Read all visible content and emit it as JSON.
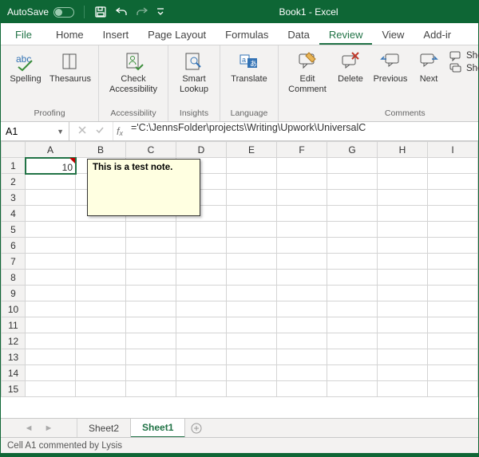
{
  "titlebar": {
    "autosave_label": "AutoSave",
    "autosave_state": "Off",
    "title": "Book1  -  Excel"
  },
  "tabs": {
    "file": "File",
    "home": "Home",
    "insert": "Insert",
    "page_layout": "Page Layout",
    "formulas": "Formulas",
    "data": "Data",
    "review": "Review",
    "view": "View",
    "addins": "Add-ir"
  },
  "ribbon": {
    "spelling": "Spelling",
    "thesaurus": "Thesaurus",
    "proofing_group": "Proofing",
    "check_accessibility": "Check Accessibility",
    "accessibility_group": "Accessibility",
    "smart_lookup": "Smart Lookup",
    "insights_group": "Insights",
    "translate": "Translate",
    "language_group": "Language",
    "edit_comment": "Edit Comment",
    "delete": "Delete",
    "previous": "Previous",
    "next": "Next",
    "comments_group": "Comments",
    "show_hide": "Show/Hide C",
    "show_all": "Show All Com"
  },
  "namebox": {
    "value": "A1"
  },
  "formula": {
    "text": "='C:\\JennsFolder\\projects\\Writing\\Upwork\\UniversalC"
  },
  "columns": [
    "A",
    "B",
    "C",
    "D",
    "E",
    "F",
    "G",
    "H",
    "I"
  ],
  "rows": [
    "1",
    "2",
    "3",
    "4",
    "5",
    "6",
    "7",
    "8",
    "9",
    "10",
    "11",
    "12",
    "13",
    "14",
    "15"
  ],
  "cells": {
    "A1": "10"
  },
  "comment": {
    "text": "This is a test note."
  },
  "sheets": {
    "sheet2": "Sheet2",
    "sheet1": "Sheet1"
  },
  "statusbar": {
    "text": "Cell A1 commented by Lysis"
  }
}
